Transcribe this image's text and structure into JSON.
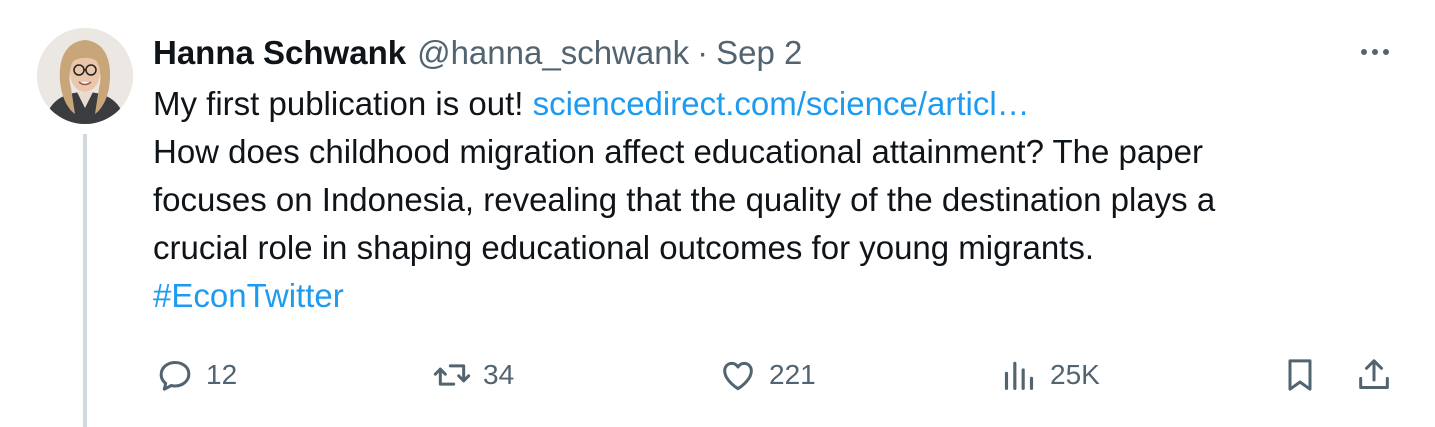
{
  "author": {
    "name": "Hanna Schwank",
    "handle": "@hanna_schwank",
    "separator": "·",
    "date": "Sep 2"
  },
  "tweet": {
    "line1_text": "My first publication is out! ",
    "link_text": "sciencedirect.com/science/articl…",
    "body_lines": [
      "How does childhood migration affect educational attainment? The paper",
      "focuses on Indonesia, revealing that the quality of the destination plays a",
      "crucial role in shaping educational outcomes for young migrants."
    ],
    "hashtag": "#EconTwitter"
  },
  "actions": {
    "replies": "12",
    "reposts": "34",
    "likes": "221",
    "views": "25K"
  },
  "icons": {
    "more": "more-horizontal-icon",
    "reply": "reply-bubble-icon",
    "repost": "repost-icon",
    "like": "heart-icon",
    "views": "analytics-icon",
    "bookmark": "bookmark-icon",
    "share": "share-icon"
  },
  "colors": {
    "text": "#0f1419",
    "secondary": "#536471",
    "link": "#1d9bf0",
    "thread_line": "#cfd9de"
  }
}
